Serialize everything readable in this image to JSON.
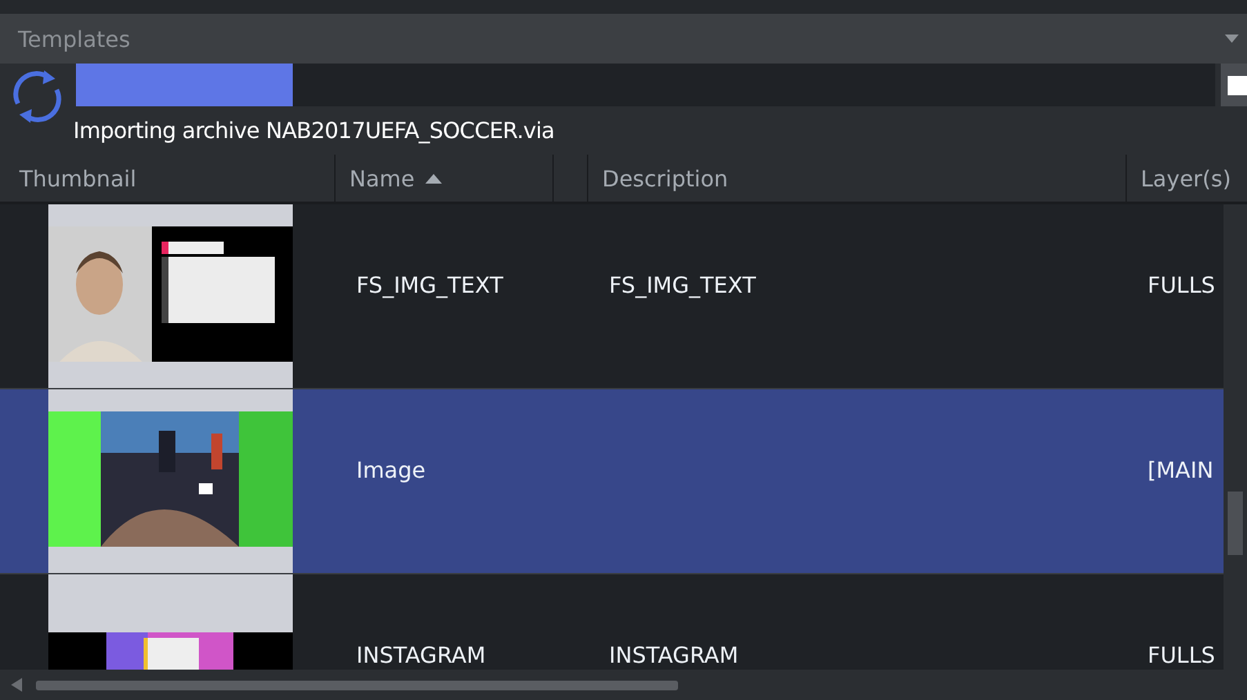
{
  "panel": {
    "title": "Templates"
  },
  "import": {
    "level": 0.19,
    "message": "Importing archive NAB2017UEFA_SOCCER.via"
  },
  "table": {
    "columns": [
      {
        "label": "Thumbnail",
        "sorted": false
      },
      {
        "label": "Name",
        "sorted": true
      },
      {
        "sorted": false
      },
      {
        "label": "Description",
        "sorted": false
      },
      {
        "label": "Layer(s)",
        "sorted": false
      }
    ],
    "rows": [
      {
        "name": "FS_IMG_TEXT",
        "description": "FS_IMG_TEXT",
        "layers": "FULLS",
        "selected": false
      },
      {
        "name": "Image",
        "layers": "[MAIN",
        "selected": true
      },
      {
        "name": "INSTAGRAM",
        "description": "INSTAGRAM",
        "layers": "FULLS",
        "selected": false
      }
    ]
  }
}
